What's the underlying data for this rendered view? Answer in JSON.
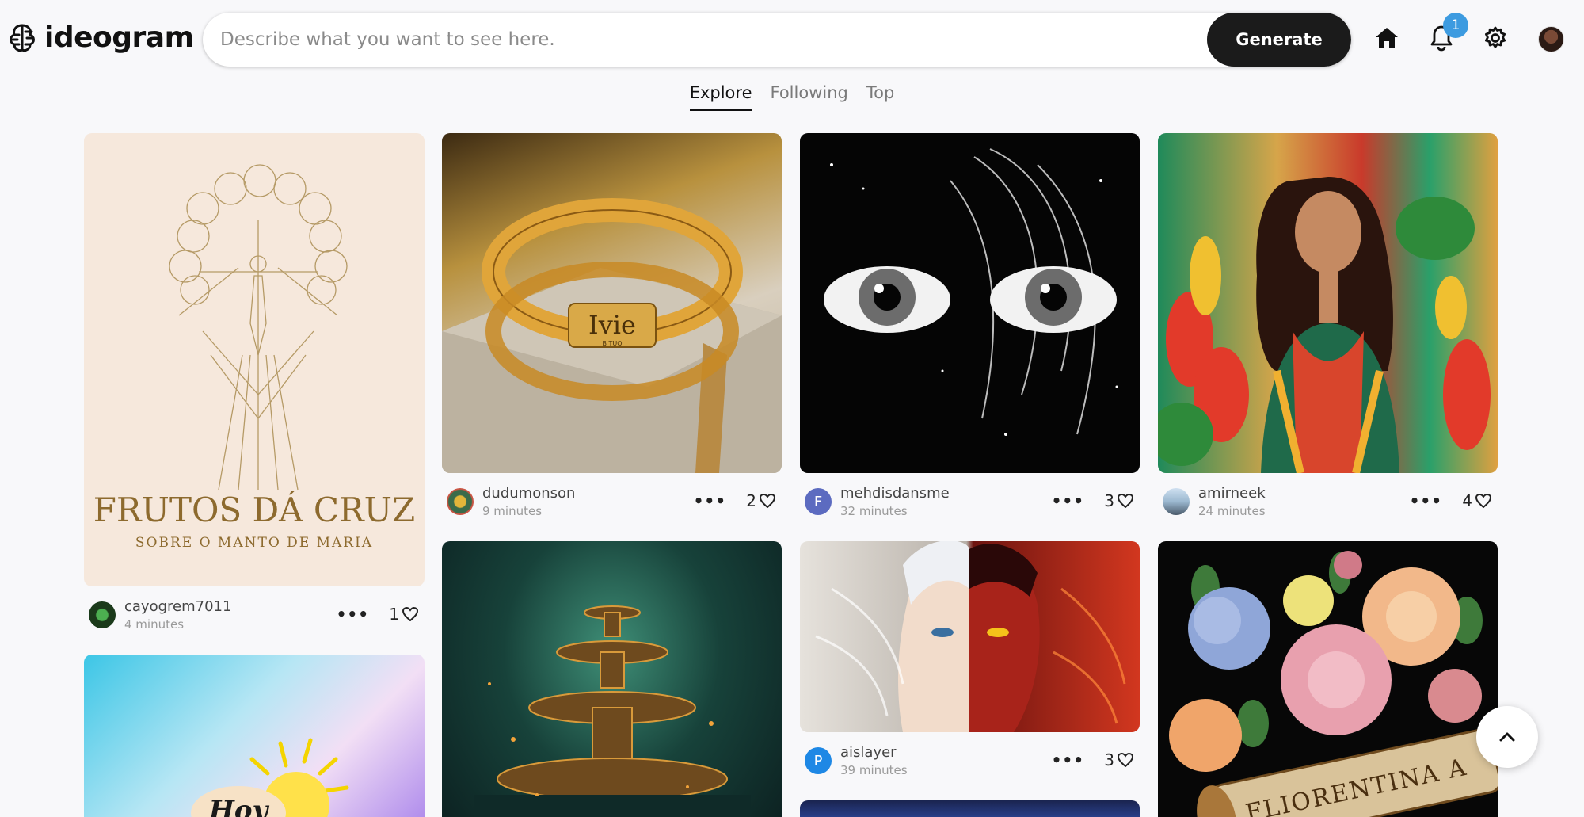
{
  "brand": {
    "name": "ideogram"
  },
  "search": {
    "placeholder": "Describe what you want to see here.",
    "value": ""
  },
  "generate_label": "Generate",
  "notifications_count": "1",
  "tabs": [
    {
      "label": "Explore",
      "active": true
    },
    {
      "label": "Following",
      "active": false
    },
    {
      "label": "Top",
      "active": false
    }
  ],
  "cards": [
    {
      "user": "cayogrem7011",
      "time": "4 minutes",
      "likes": "1",
      "image_text": {
        "title": "FRUTOS DÁ CRUZ",
        "subtitle": "SOBRE O MANTO DE MARIA"
      }
    },
    {
      "user": "dudumonson",
      "time": "9 minutes",
      "likes": "2",
      "image_text": {
        "name": "Ivie",
        "small": "B TUO"
      }
    },
    {
      "user": "mehdisdansme",
      "time": "32 minutes",
      "likes": "3",
      "avatar_letter": "F"
    },
    {
      "user": "amirneek",
      "time": "24 minutes",
      "likes": "4"
    },
    {
      "user": "aislayer",
      "time": "39 minutes",
      "likes": "3",
      "avatar_letter": "P"
    },
    {
      "image_text": {
        "scroll": "FLIORENTINA A"
      }
    },
    {
      "image_text": {
        "word": "Hoy"
      }
    }
  ],
  "colors": {
    "accent": "#1b1b1b",
    "badge": "#3d9be0",
    "avatar_purple": "#5c6bc0",
    "avatar_blue": "#1e88e5"
  },
  "icons": [
    "brain-logo-icon",
    "home-icon",
    "bell-icon",
    "gear-icon",
    "more-icon",
    "heart-icon",
    "chevron-up-icon"
  ]
}
